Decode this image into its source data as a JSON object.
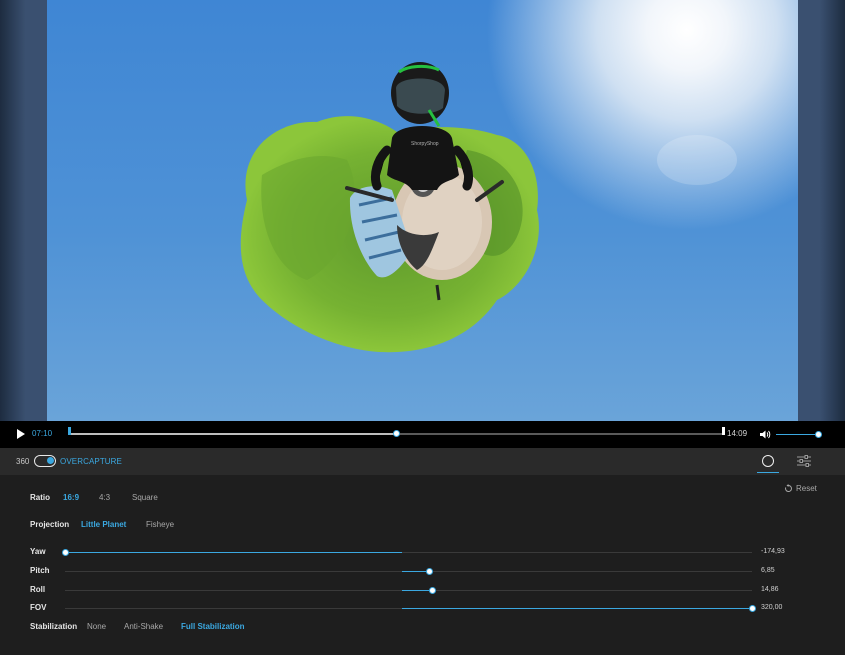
{
  "player": {
    "current_time": "07:10",
    "total_time": "14:09",
    "playhead_fraction": 0.5,
    "volume_fraction": 1.0,
    "play_icon": "play-icon",
    "volume_icon": "speaker-icon"
  },
  "mode_bar": {
    "label_360": "360",
    "overcapture_label": "OVERCAPTURE",
    "overcapture_on": true,
    "tabs": [
      "framing-circle-icon",
      "adjust-sliders-icon"
    ],
    "active_tab": "framing"
  },
  "settings": {
    "reset_label": "Reset",
    "ratio": {
      "label": "Ratio",
      "options": [
        "16:9",
        "4:3",
        "Square"
      ],
      "selected": "16:9"
    },
    "projection": {
      "label": "Projection",
      "options": [
        "Little Planet",
        "Fisheye"
      ],
      "selected": "Little Planet"
    },
    "sliders": [
      {
        "label": "Yaw",
        "value": "-174,93",
        "fraction": 0.0
      },
      {
        "label": "Pitch",
        "value": "6,85",
        "fraction": 0.53
      },
      {
        "label": "Roll",
        "value": "14,86",
        "fraction": 0.535
      },
      {
        "label": "FOV",
        "value": "320,00",
        "fraction": 1.0
      }
    ],
    "stabilization": {
      "label": "Stabilization",
      "options": [
        "None",
        "Anti-Shake",
        "Full Stabilization"
      ],
      "selected": "Full Stabilization"
    }
  },
  "colors": {
    "accent": "#3ba8e0",
    "panel_bg": "#1e1e1e",
    "bar_bg": "#2a2a2a"
  }
}
